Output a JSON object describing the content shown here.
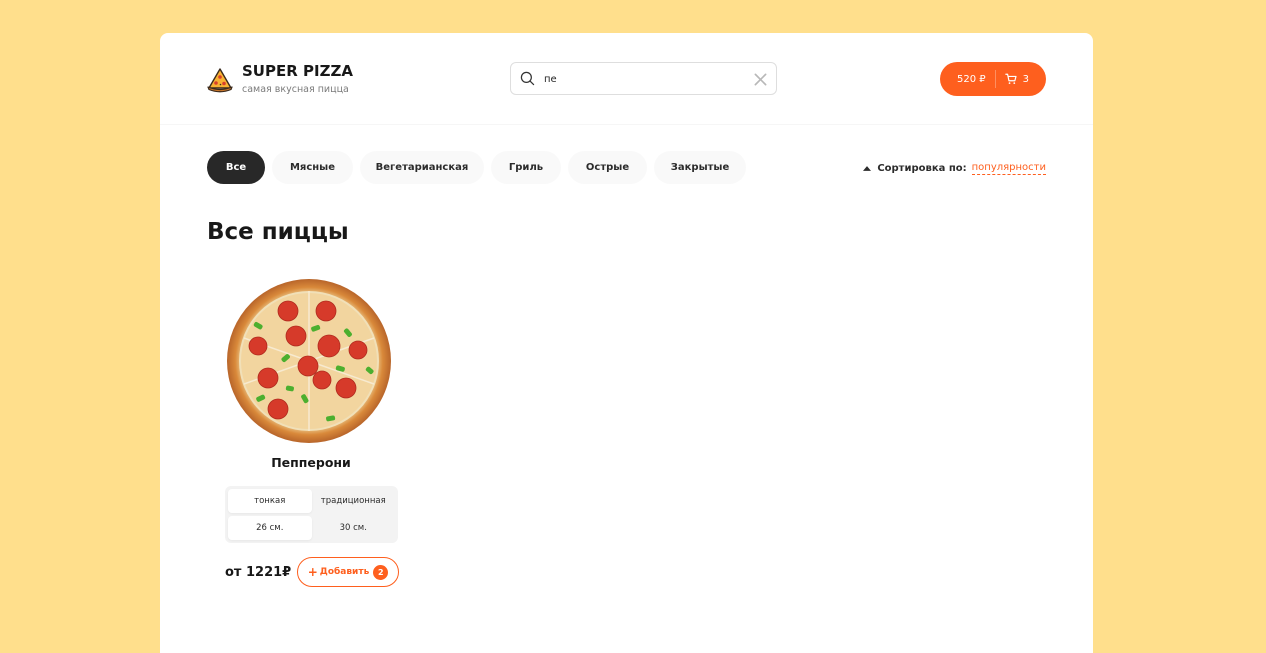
{
  "header": {
    "logo_title": "SUPER PIZZA",
    "logo_subtitle": "самая вкусная пицца",
    "search": {
      "value": "пе",
      "placeholder": ""
    },
    "cart": {
      "total": "520 ₽",
      "count": "3"
    }
  },
  "categories": [
    "Все",
    "Мясные",
    "Вегетарианская",
    "Гриль",
    "Острые",
    "Закрытые"
  ],
  "active_category": "Все",
  "sort": {
    "label": "Сортировка по:",
    "value": "популярности"
  },
  "page_title": "Все пиццы",
  "pizzas": [
    {
      "name": "Пепперони",
      "types": [
        "тонкая",
        "традиционная"
      ],
      "active_type": "тонкая",
      "sizes": [
        "26 см.",
        "30 см."
      ],
      "active_size": "26 см.",
      "price": "от 1221₽",
      "add_label": "Добавить",
      "add_count": "2"
    }
  ],
  "colors": {
    "background": "#ffdf8c",
    "accent": "#fe5f1e",
    "active_category": "#282828"
  },
  "icons": {
    "logo": "pizza-slice-icon",
    "search": "search-icon",
    "clear": "close-icon",
    "cart": "cart-icon",
    "sort": "caret-up-icon",
    "add": "plus-icon"
  }
}
